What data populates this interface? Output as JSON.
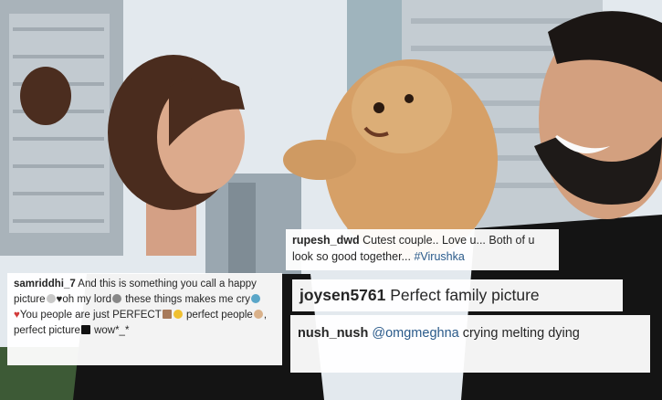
{
  "comments": {
    "rupesh": {
      "username": "rupesh_dwd",
      "text": " Cutest couple.. Love u... Both of u look so good together... ",
      "hashtag": "#Virushka"
    },
    "samriddhi": {
      "username": "samriddhi_7",
      "text_1": " And this is something you call a happy picture",
      "text_2": "oh my lord",
      "text_3": " these things makes me cry",
      "text_4": "You people are just PERFECT",
      "text_5": " perfect people",
      "text_6": ", perfect picture",
      "text_7": " wow*_*"
    },
    "joysen": {
      "username": "joysen5761",
      "text": " Perfect family picture"
    },
    "nush": {
      "username": "nush_nush",
      "mention": "@omgmeghna",
      "text": " crying melting dying"
    }
  },
  "colors": {
    "sky": "#e6ebef",
    "building": "#b7c0c8",
    "hair": "#4a2c1e",
    "skin": "#d9a484",
    "dog": "#d6a067",
    "black_shirt": "#151515",
    "beard": "#1e1a18",
    "mention": "#2a5a8a"
  }
}
